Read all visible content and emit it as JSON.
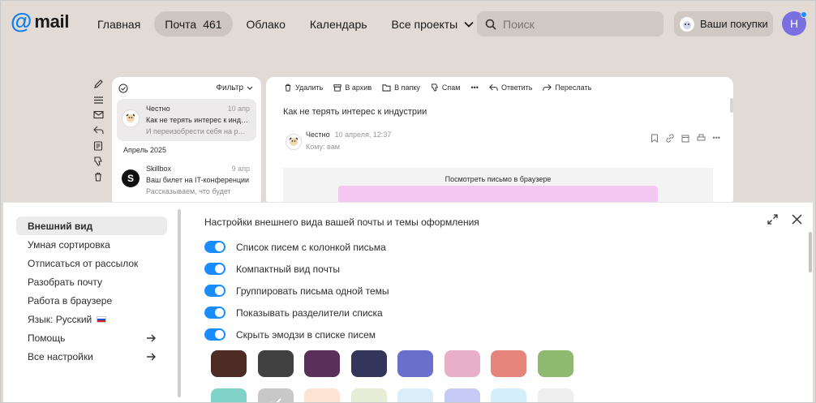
{
  "logo": {
    "at": "@",
    "word": "mail"
  },
  "nav": {
    "items": [
      {
        "label": "Главная",
        "count": ""
      },
      {
        "label": "Почта",
        "count": "461"
      },
      {
        "label": "Облако",
        "count": ""
      },
      {
        "label": "Календарь",
        "count": ""
      },
      {
        "label": "Все проекты",
        "count": ""
      }
    ]
  },
  "search": {
    "placeholder": "Поиск"
  },
  "shop": {
    "label": "Ваши покупки"
  },
  "user": {
    "initial": "Н"
  },
  "list": {
    "filter_label": "Фильтр",
    "group_label": "Апрель 2025",
    "messages": [
      {
        "from": "Честно",
        "date": "10 апр",
        "subject": "Как не терять интерес к индустрии",
        "snippet": "И переизобрести себя на рынке"
      },
      {
        "from": "Skillbox",
        "date": "9 апр",
        "subject": "Ваш билет на IT-конференции",
        "snippet": "Рассказываем, что будет"
      }
    ]
  },
  "reader": {
    "toolbar": {
      "delete": "Удалить",
      "archive": "В архив",
      "folder": "В папку",
      "spam": "Спам",
      "reply": "Ответить",
      "forward": "Переслать"
    },
    "subject": "Как не терять интерес к индустрии",
    "from": "Честно",
    "date": "10 апреля, 12:37",
    "to": "Кому: вам",
    "browser_link": "Посмотреть письмо в браузере"
  },
  "settings": {
    "sidebar": [
      {
        "label": "Внешний вид"
      },
      {
        "label": "Умная сортировка"
      },
      {
        "label": "Отписаться от рассылок"
      },
      {
        "label": "Разобрать почту"
      },
      {
        "label": "Работа в браузере"
      },
      {
        "label": "Язык: Русский"
      },
      {
        "label": "Помощь"
      },
      {
        "label": "Все настройки"
      }
    ],
    "heading": "Настройки внешнего вида вашей почты и темы оформления",
    "toggles": [
      {
        "label": "Список писем с колонкой письма",
        "on": true
      },
      {
        "label": "Компактный вид почты",
        "on": true
      },
      {
        "label": "Группировать письма одной темы",
        "on": true
      },
      {
        "label": "Показывать разделители списка",
        "on": true
      },
      {
        "label": "Скрыть эмодзи в списке писем",
        "on": true
      }
    ],
    "themes_row1": [
      "#4e2c26",
      "#404040",
      "#59305a",
      "#33355a",
      "#6b6fcc",
      "#e8b0c8",
      "#e5847a",
      "#8fb870"
    ],
    "themes_row2": [
      "#7fd3c9",
      "#c8c8c8",
      "#fde4d2",
      "#e6ecd6",
      "#d9eef8",
      "#c6cbf5",
      "#d4effa",
      "#eeeeee"
    ]
  },
  "colors": {
    "accent": "#1a8cff",
    "logo": "#0d7ef0",
    "avatar": "#7a6fe0",
    "background": "#e2dbd5"
  }
}
